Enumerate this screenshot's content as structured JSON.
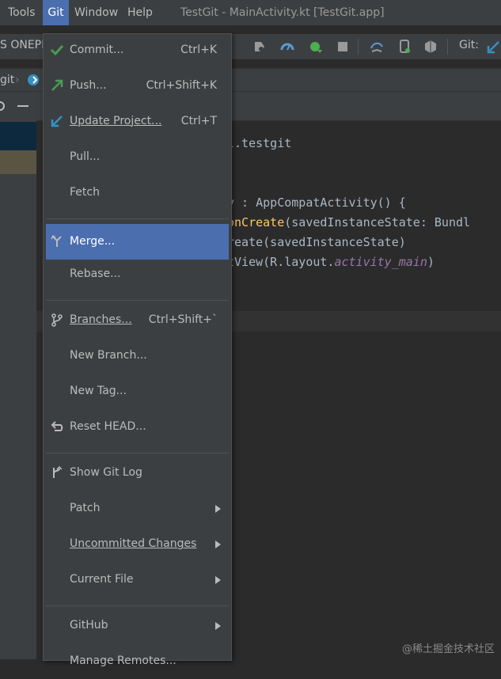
{
  "menubar": {
    "items": [
      "Tools",
      "Git",
      "Window",
      "Help"
    ],
    "title": "TestGit - MainActivity.kt [TestGit.app]"
  },
  "toolbar": {
    "device_label": "S ONEPL",
    "git_label": "Git:"
  },
  "navbar": {
    "crumb": "git"
  },
  "editor": {
    "lines": [
      {
        "parts": [
          {
            "t": "l.testgit",
            "c": "#a9b7c6"
          }
        ]
      },
      {
        "parts": []
      },
      {
        "parts": []
      },
      {
        "parts": [
          {
            "t": "y : AppCompatActivity() {",
            "c": "#a9b7c6"
          }
        ]
      },
      {
        "parts": [
          {
            "t": "onCreate",
            "c": "#ffc66d"
          },
          {
            "t": "(savedInstanceState: Bundl",
            "c": "#a9b7c6"
          }
        ]
      },
      {
        "parts": [
          {
            "t": "reate(savedInstanceState)",
            "c": "#a9b7c6"
          }
        ]
      },
      {
        "parts": [
          {
            "t": "tView(R.layout.",
            "c": "#a9b7c6"
          },
          {
            "t": "activity_main",
            "c": "#9876aa",
            "i": true
          },
          {
            "t": ")",
            "c": "#a9b7c6"
          }
        ]
      },
      {
        "parts": []
      },
      {
        "parts": []
      }
    ]
  },
  "git_menu": {
    "items": [
      {
        "label": "Commit...",
        "shortcut": "Ctrl+K",
        "icon": "check-icon"
      },
      {
        "label": "Push...",
        "shortcut": "Ctrl+Shift+K",
        "icon": "push-arrow-icon"
      },
      {
        "label": "Update Project...",
        "shortcut": "Ctrl+T",
        "icon": "update-arrow-icon"
      },
      {
        "label": "Pull...",
        "shortcut": "",
        "icon": ""
      },
      {
        "label": "Fetch",
        "shortcut": "",
        "icon": ""
      },
      {
        "label": "Merge...",
        "shortcut": "",
        "icon": "merge-icon",
        "selected": true
      },
      {
        "label": "Rebase...",
        "shortcut": "",
        "icon": ""
      },
      {
        "label": "Branches...",
        "shortcut": "Ctrl+Shift+`",
        "icon": "branch-icon"
      },
      {
        "label": "New Branch...",
        "shortcut": "",
        "icon": ""
      },
      {
        "label": "New Tag...",
        "shortcut": "",
        "icon": ""
      },
      {
        "label": "Reset HEAD...",
        "shortcut": "",
        "icon": "reset-icon"
      },
      {
        "label": "Show Git Log",
        "shortcut": "",
        "icon": "git-log-icon"
      },
      {
        "label": "Patch",
        "shortcut": "",
        "icon": "",
        "submenu": true
      },
      {
        "label": "Uncommitted Changes",
        "shortcut": "",
        "icon": "",
        "submenu": true
      },
      {
        "label": "Current File",
        "shortcut": "",
        "icon": "",
        "submenu": true
      },
      {
        "label": "GitHub",
        "shortcut": "",
        "icon": "",
        "submenu": true
      },
      {
        "label": "Manage Remotes...",
        "shortcut": "",
        "icon": ""
      }
    ]
  },
  "watermark": "@稀土掘金技术社区",
  "colors": {
    "menubar_bg": "#3c3f41",
    "selection": "#4b6eaf",
    "editor_bg": "#2b2b2b",
    "text": "#bbbbbb"
  }
}
